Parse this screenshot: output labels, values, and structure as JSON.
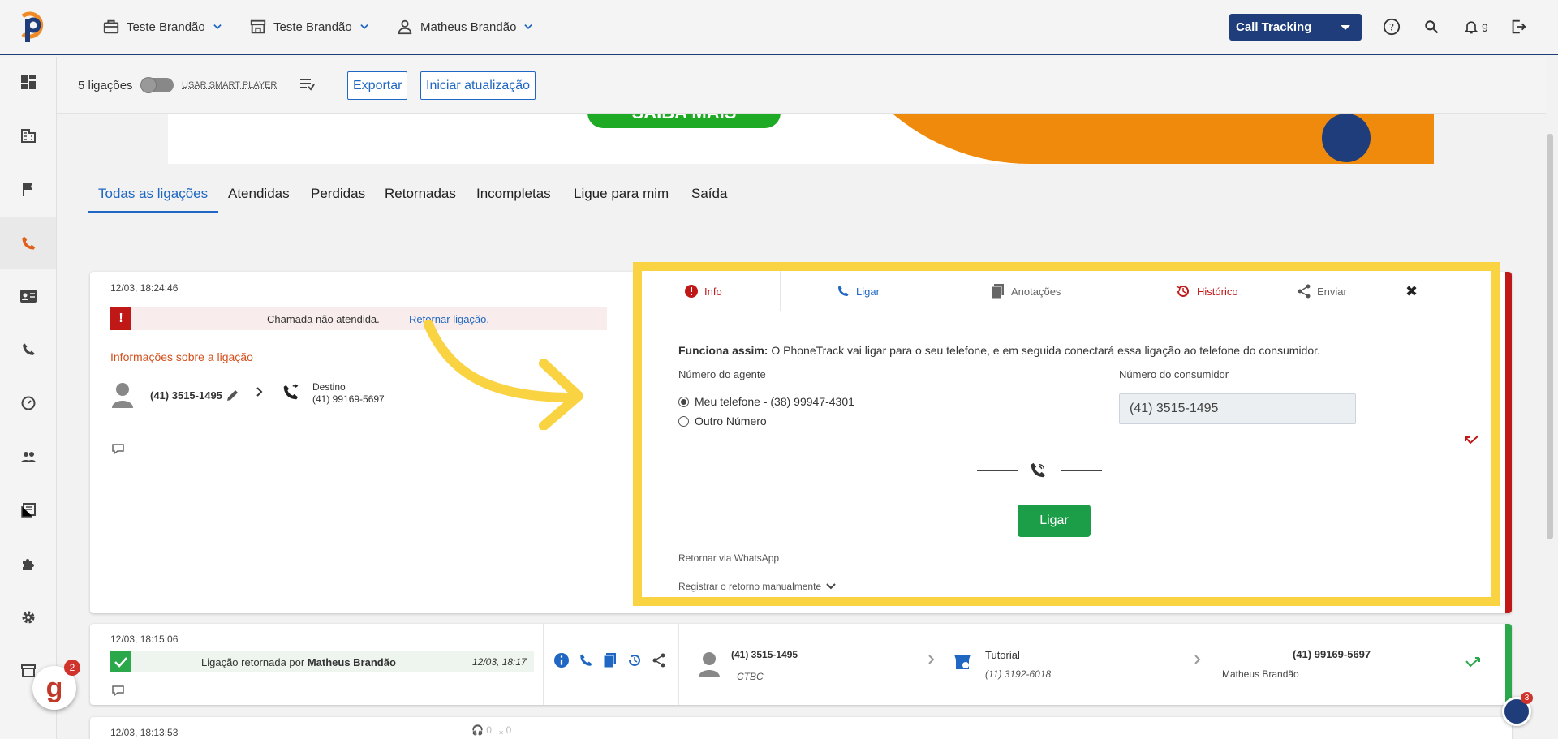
{
  "topbar": {
    "company": "Teste Brandão",
    "store": "Teste Brandão",
    "user": "Matheus Brandão",
    "product_button": "Call Tracking",
    "notification_count": "9"
  },
  "toolbar": {
    "count": "5 ligações",
    "smart_player": "USAR SMART PLAYER",
    "export": "Exportar",
    "start_update": "Iniciar atualização"
  },
  "tabs": [
    "Todas as ligações",
    "Atendidas",
    "Perdidas",
    "Retornadas",
    "Incompletas",
    "Ligue para mim",
    "Saída"
  ],
  "banner": {
    "text": "SAIBA MAIS"
  },
  "call1": {
    "datetime": "12/03, 18:24:46",
    "status": "Chamada não atendida.",
    "status_link": "Retornar ligação.",
    "info_title": "Informações sobre a ligação",
    "caller": "(41) 3515-1495",
    "dest_label": "Destino",
    "dest_number": "(41) 99169-5697"
  },
  "popup": {
    "tabs": {
      "info": "Info",
      "ligar": "Ligar",
      "anotacoes": "Anotações",
      "historico": "Histórico",
      "enviar": "Enviar"
    },
    "desc_bold": "Funciona assim:",
    "desc": "O PhoneTrack vai ligar para o seu telefone, e em seguida conectará essa ligação ao telefone do consumidor.",
    "agent_label": "Número do agente",
    "consumer_label": "Número do consumidor",
    "option1": "Meu telefone - (38) 99947-4301",
    "option2": "Outro Número",
    "consumer_number": "(41) 3515-1495",
    "call_button": "Ligar",
    "whatsapp": "Retornar via WhatsApp",
    "manual": "Registrar o retorno manualmente"
  },
  "call2": {
    "datetime": "12/03, 18:15:06",
    "status_prefix": "Ligação retornada por",
    "status_user": "Matheus Brandão",
    "status_time": "12/03, 18:17",
    "caller": "(41) 3515-1495",
    "carrier": "CTBC",
    "campaign": "Tutorial",
    "campaign_number": "(11) 3192-6018",
    "destination": "(41) 99169-5697",
    "attendant": "Matheus Brandão"
  },
  "call3": {
    "datetime": "12/03, 18:13:53",
    "listens": "0",
    "downloads": "0"
  },
  "chat_badge": "2",
  "help_badge": "3",
  "colors": {
    "brand": "#1f3d7a",
    "link": "#1f67c2",
    "highlight": "#f9d342",
    "success": "#1c9e48",
    "danger": "#c01717"
  }
}
